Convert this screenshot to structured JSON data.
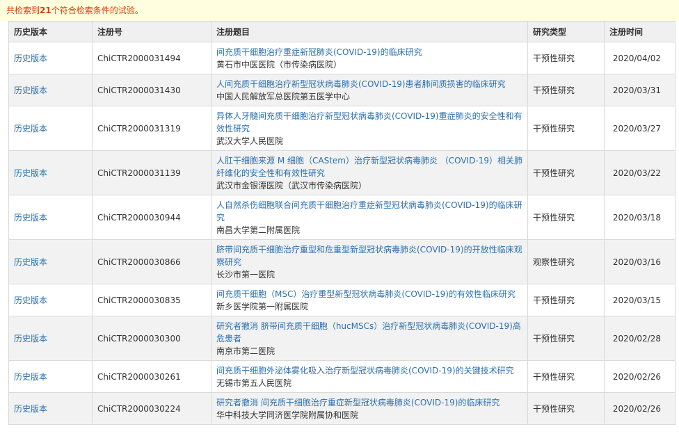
{
  "notice": {
    "prefix": "共检索到",
    "count": "21",
    "suffix": "个符合检索条件的试验。"
  },
  "headers": [
    "历史版本",
    "注册号",
    "注册题目",
    "研究类型",
    "注册时间"
  ],
  "rows": [
    {
      "history": "历史版本",
      "reg": "ChiCTR2000031494",
      "title": "间充质干细胞治疗重症新冠肺炎(COVID-19)的临床研究",
      "inst": "黄石市中医医院（市传染病医院）",
      "type": "干预性研究",
      "date": "2020/04/02"
    },
    {
      "history": "历史版本",
      "reg": "ChiCTR2000031430",
      "title": "人间充质干细胞治疗新型冠状病毒肺炎(COVID-19)患者肺间质损害的临床研究",
      "inst": "中国人民解放军总医院第五医学中心",
      "type": "干预性研究",
      "date": "2020/03/31"
    },
    {
      "history": "历史版本",
      "reg": "ChiCTR2000031319",
      "title": "异体人牙髓间充质干细胞治疗新型冠状病毒肺炎(COVID-19)重症肺炎的安全性和有效性研究",
      "inst": "武汉大学人民医院",
      "type": "干预性研究",
      "date": "2020/03/27"
    },
    {
      "history": "历史版本",
      "reg": "ChiCTR2000031139",
      "title": "人肛干细胞来源 M 细胞（CAStem）治疗新型冠状病毒肺炎 （COVID-19）相关肺纤维化的安全性和有效性研究",
      "inst": "武汉市金银潭医院（武汉市传染病医院）",
      "type": "干预性研究",
      "date": "2020/03/22"
    },
    {
      "history": "历史版本",
      "reg": "ChiCTR2000030944",
      "title": "人自然杀伤细胞联合间充质干细胞治疗重症新型冠状病毒肺炎(COVID-19)的临床研究",
      "inst": "南昌大学第二附属医院",
      "type": "干预性研究",
      "date": "2020/03/18"
    },
    {
      "history": "历史版本",
      "reg": "ChiCTR2000030866",
      "title": "脐带间充质干细胞治疗重型和危重型新型冠状病毒肺炎(COVID-19)的开放性临床观察研究",
      "inst": "长沙市第一医院",
      "type": "观察性研究",
      "date": "2020/03/16"
    },
    {
      "history": "历史版本",
      "reg": "ChiCTR2000030835",
      "title": "间充质干细胞（MSC）治疗重型新型冠状病毒肺炎(COVID-19)的有效性临床研究",
      "inst": "新乡医学院第一附属医院",
      "type": "干预性研究",
      "date": "2020/03/15"
    },
    {
      "history": "历史版本",
      "reg": "ChiCTR2000030300",
      "title": "研究者撤消 脐带间充质干细胞（hucMSCs）治疗新型冠状病毒肺炎(COVID-19)高危患者",
      "inst": "南京市第二医院",
      "type": "干预性研究",
      "date": "2020/02/28"
    },
    {
      "history": "历史版本",
      "reg": "ChiCTR2000030261",
      "title": "间充质干细胞外泌体雾化吸入治疗新型冠状病毒肺炎(COVID-19)的关键技术研究",
      "inst": "无锡市第五人民医院",
      "type": "干预性研究",
      "date": "2020/02/26"
    },
    {
      "history": "历史版本",
      "reg": "ChiCTR2000030224",
      "title": "研究者撤消 间充质干细胞治疗重症新型冠状病毒肺炎(COVID-19)的临床研究",
      "inst": "华中科技大学同济医学院附属协和医院",
      "type": "干预性研究",
      "date": "2020/02/26"
    }
  ]
}
